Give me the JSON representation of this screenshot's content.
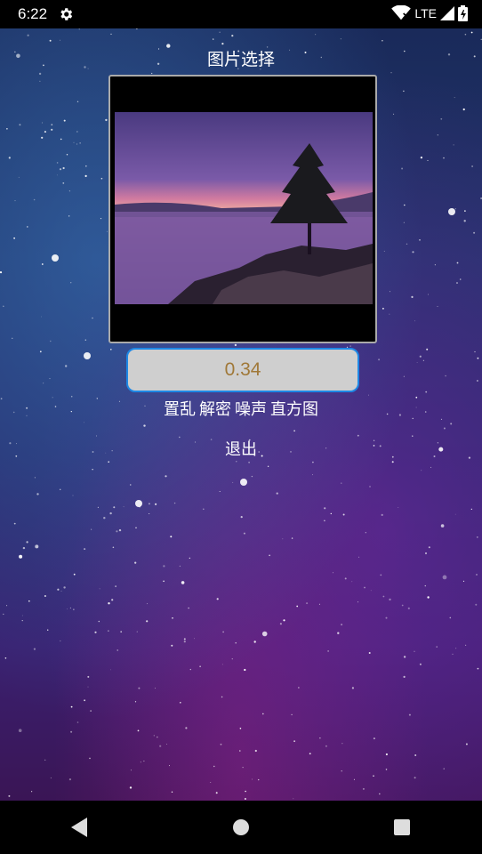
{
  "status_bar": {
    "time": "6:22",
    "network": "LTE"
  },
  "main": {
    "title": "图片选择",
    "value_field": "0.34",
    "actions": [
      "置乱",
      "解密",
      "噪声",
      "直方图"
    ],
    "exit_label": "退出"
  },
  "icons": [
    "gear-icon",
    "wifi-icon",
    "signal-icon",
    "battery-icon",
    "back-icon",
    "home-icon",
    "recents-icon"
  ],
  "colors": {
    "field_border": "#1e88e5",
    "field_text": "#a07838",
    "field_bg": "#cfcfcf"
  }
}
